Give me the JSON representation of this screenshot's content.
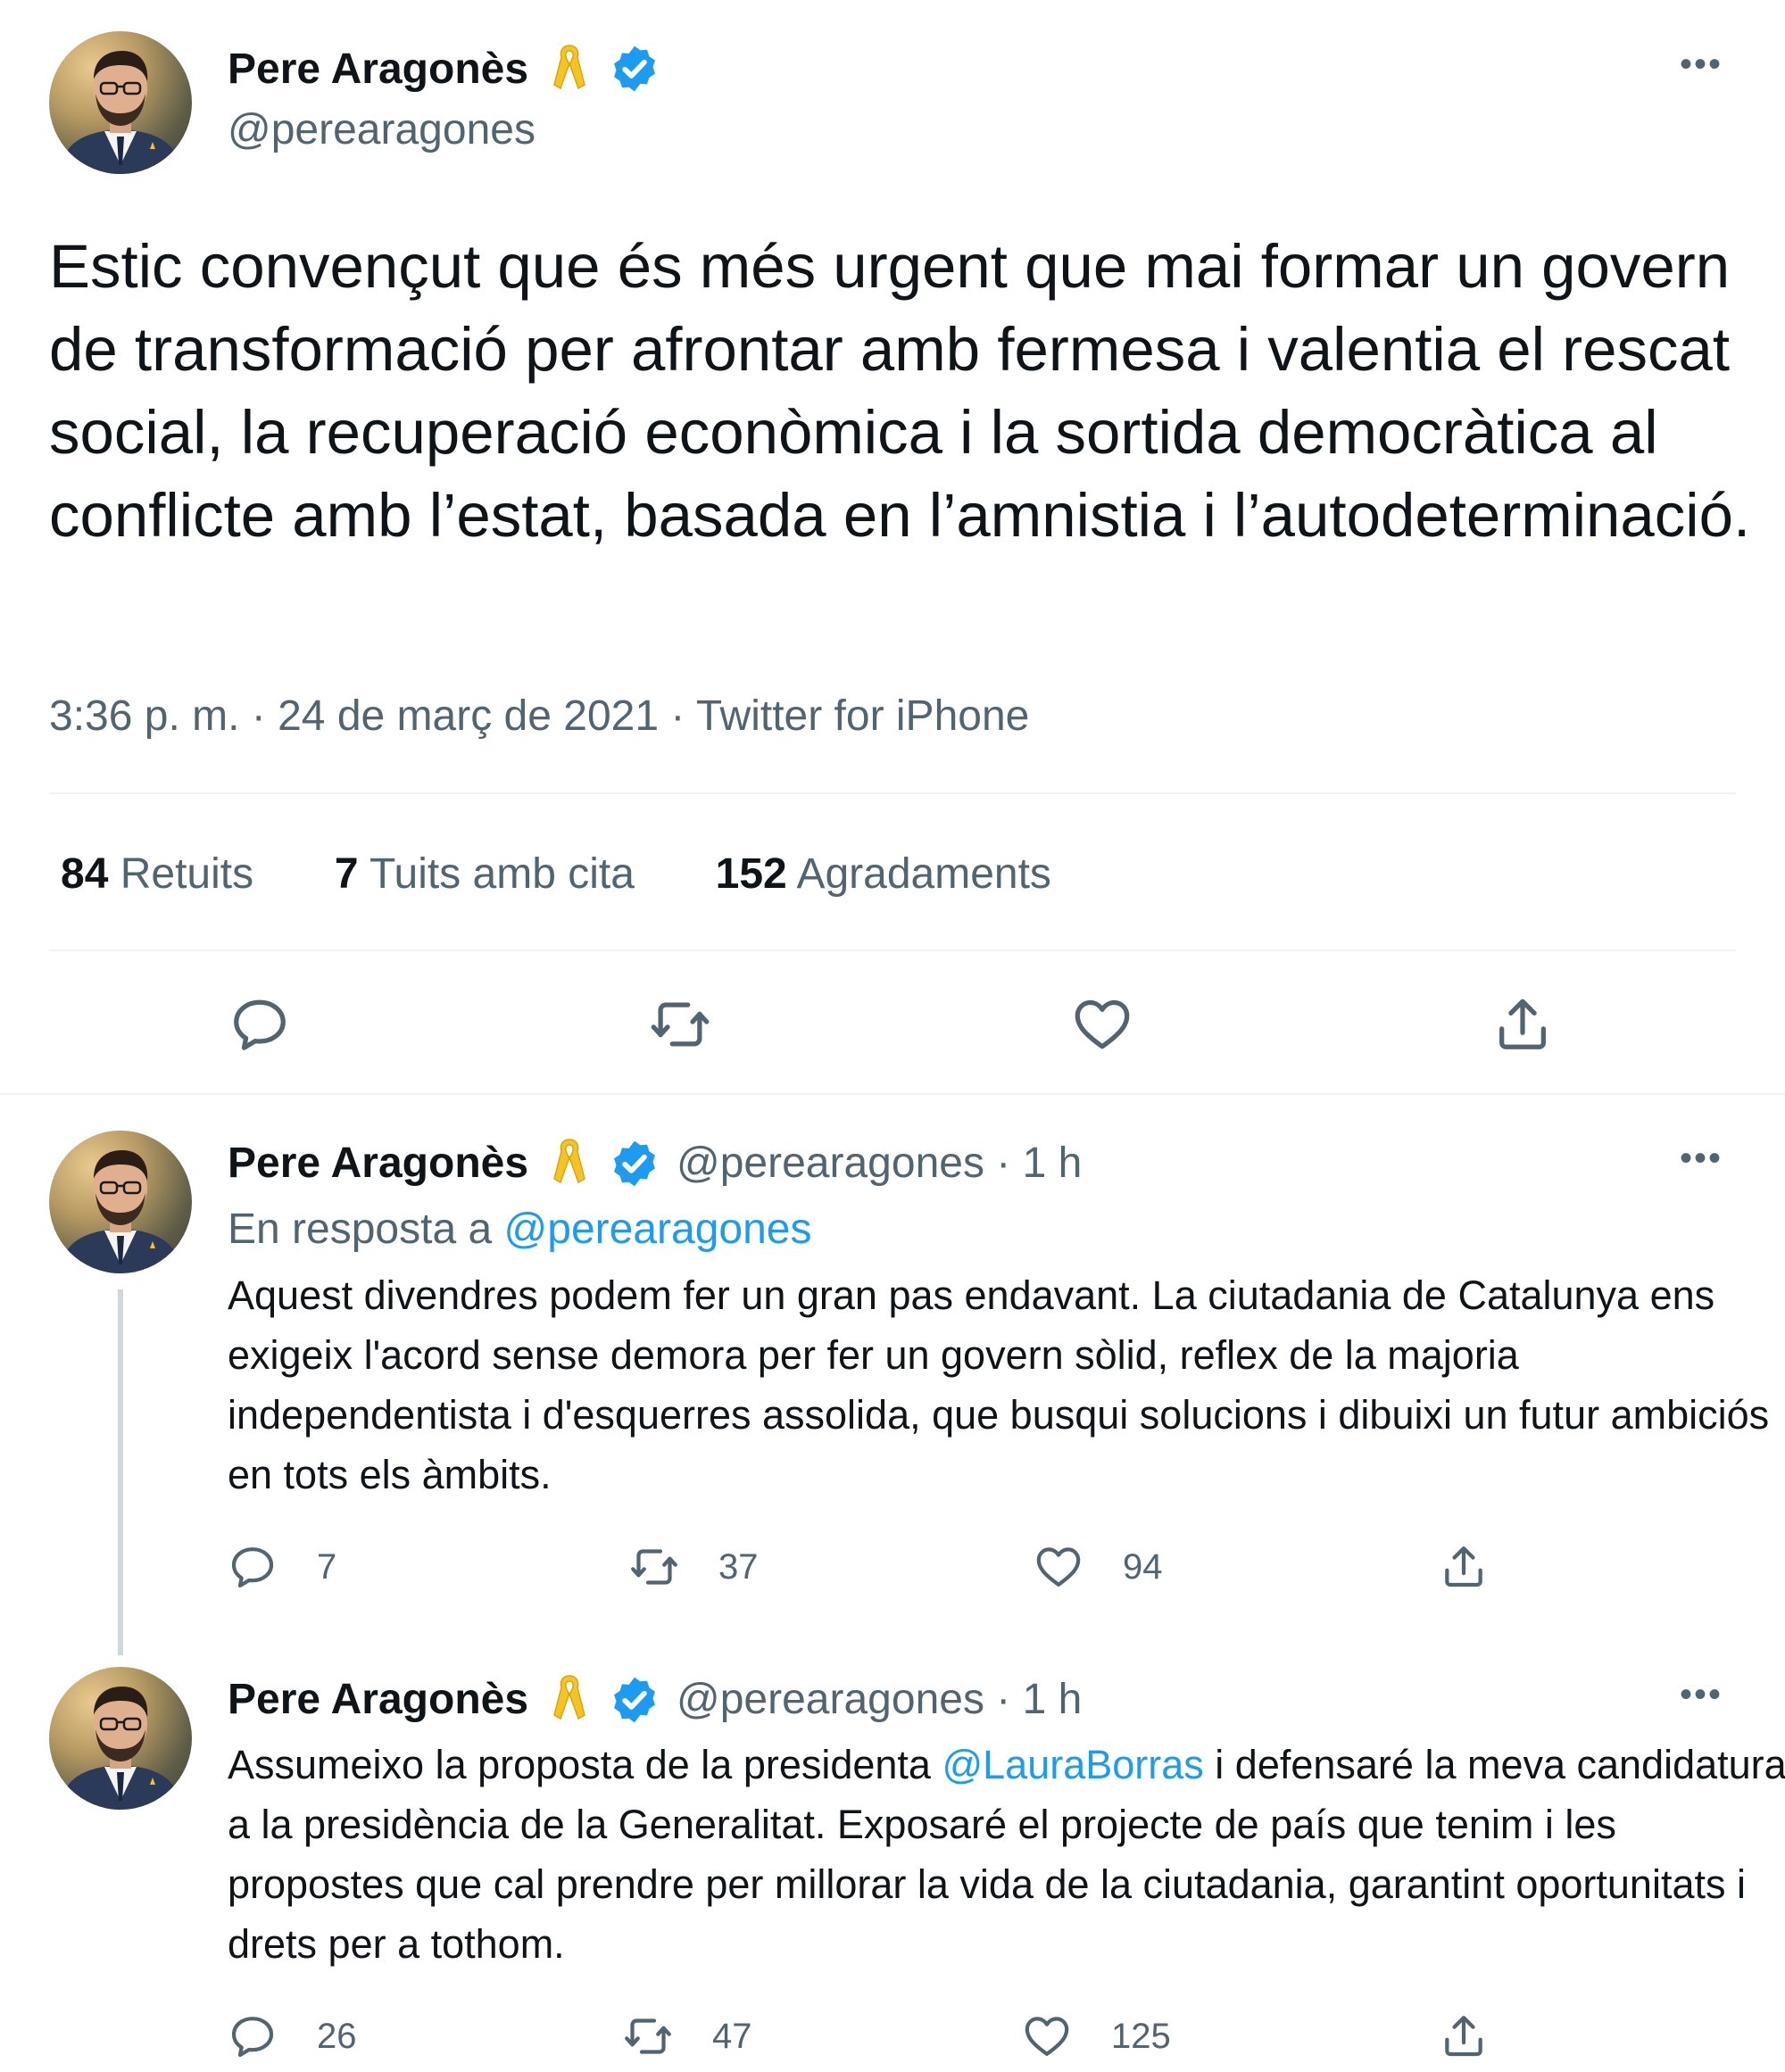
{
  "main_tweet": {
    "author_name": "Pere Aragonès",
    "author_handle": "@perearagones",
    "text": "Estic convençut que és més urgent que mai formar un govern de transformació per afrontar amb fermesa i valentia el rescat social, la recuperació econòmica i la sortida democràtica al conflicte amb l’estat, basada en l’amnistia i l’autodeterminació.",
    "meta": "3:36 p. m. · 24 de març de 2021 · Twitter for iPhone",
    "stats": {
      "retweets_count": "84",
      "retweets_label": "Retuits",
      "quotes_count": "7",
      "quotes_label": "Tuits amb cita",
      "likes_count": "152",
      "likes_label": "Agradaments"
    }
  },
  "replies": [
    {
      "author_name": "Pere Aragonès",
      "author_handle_time": "@perearagones · 1 h",
      "in_reply_prefix": "En resposta a ",
      "in_reply_handle": "@perearagones",
      "text": "Aquest divendres podem fer un gran pas endavant. La ciutadania de Catalunya ens exigeix l'acord sense demora per fer un govern sòlid, reflex de la majoria independentista i d'esquerres assolida, que busqui solucions i dibuixi un futur ambiciós en tots els àmbits.",
      "reply_count": "7",
      "retweet_count": "37",
      "like_count": "94"
    },
    {
      "author_name": "Pere Aragonès",
      "author_handle_time": "@perearagones · 1 h",
      "text_before": "Assumeixo la proposta de la presidenta ",
      "mention": "@LauraBorras",
      "text_after": " i defensaré la meva candidatura a la presidència de la Generalitat. Exposaré el projecte de país que tenim i les propostes que cal prendre per millorar la vida de la ciutadania, garantint oportunitats i drets per a tothom.",
      "reply_count": "26",
      "retweet_count": "47",
      "like_count": "125"
    }
  ],
  "icons": {
    "ribbon": "yellow-ribbon-icon",
    "verified": "verified-badge-icon",
    "more": "more-options-icon",
    "reply": "reply-icon",
    "retweet": "retweet-icon",
    "like": "like-icon",
    "share": "share-icon"
  },
  "colors": {
    "accent": "#1d9bf0",
    "ribbon": "#f5c423",
    "secondary_text": "#536471",
    "divider": "#eff3f4"
  }
}
